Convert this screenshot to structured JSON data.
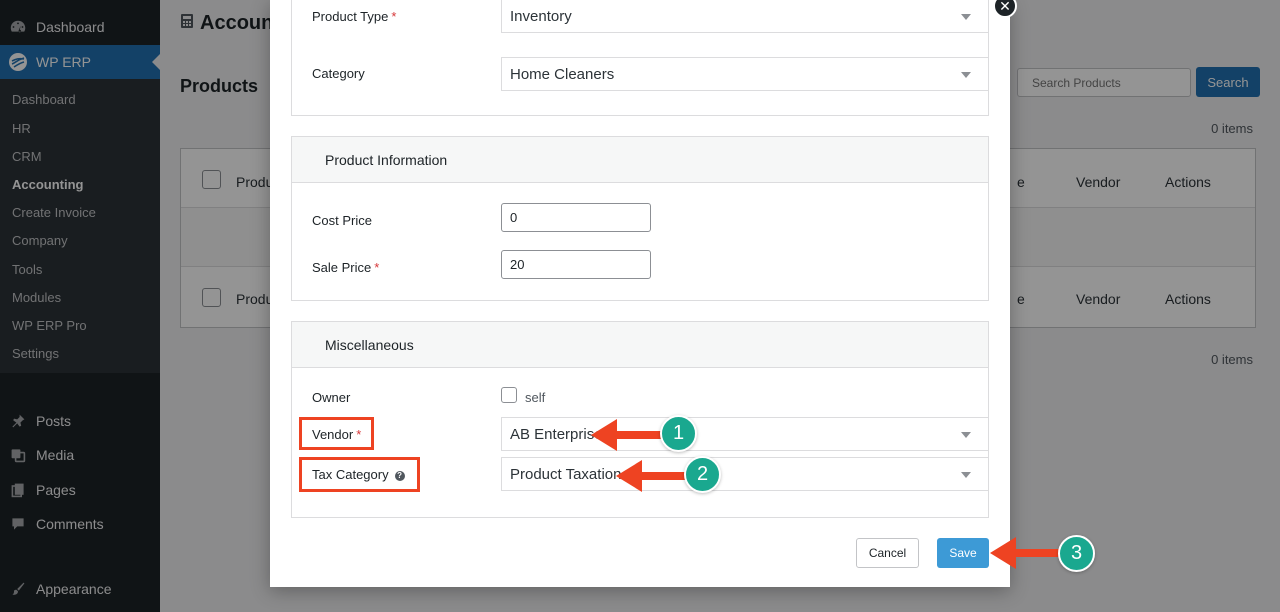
{
  "sidebar": {
    "top": {
      "dashboard": "Dashboard",
      "erp": "WP ERP"
    },
    "submenu": [
      "Dashboard",
      "HR",
      "CRM",
      "Accounting",
      "Create Invoice",
      "Company",
      "Tools",
      "Modules",
      "WP ERP Pro",
      "Settings"
    ],
    "bottom": {
      "posts": "Posts",
      "media": "Media",
      "pages": "Pages",
      "comments": "Comments",
      "appearance": "Appearance"
    }
  },
  "page": {
    "heading": "Accoun",
    "title": "Products",
    "search_placeholder": "Search Products",
    "search_button": "Search",
    "items_count": "0 items",
    "columns": {
      "product": "Produ",
      "cost": "e",
      "vendor": "Vendor",
      "actions": "Actions"
    }
  },
  "modal": {
    "product_type": {
      "label": "Product Type",
      "required": "*",
      "value": "Inventory"
    },
    "category": {
      "label": "Category",
      "value": "Home Cleaners"
    },
    "product_info": {
      "heading": "Product Information",
      "cost_price": {
        "label": "Cost Price",
        "value": "0"
      },
      "sale_price": {
        "label": "Sale Price",
        "required": "*",
        "value": "20"
      }
    },
    "misc": {
      "heading": "Miscellaneous",
      "owner": {
        "label": "Owner",
        "checkbox_label": "self",
        "checked": false
      },
      "vendor": {
        "label": "Vendor",
        "required": "*",
        "value": "AB Enterprise"
      },
      "tax_category": {
        "label": "Tax Category",
        "help": "?",
        "value": "Product Taxation"
      }
    },
    "buttons": {
      "cancel": "Cancel",
      "save": "Save"
    },
    "close": "✕"
  },
  "annotations": {
    "colors": {
      "arrow": "#ee4322",
      "badge": "#1aa88f"
    },
    "badges": [
      "1",
      "2",
      "3"
    ]
  }
}
